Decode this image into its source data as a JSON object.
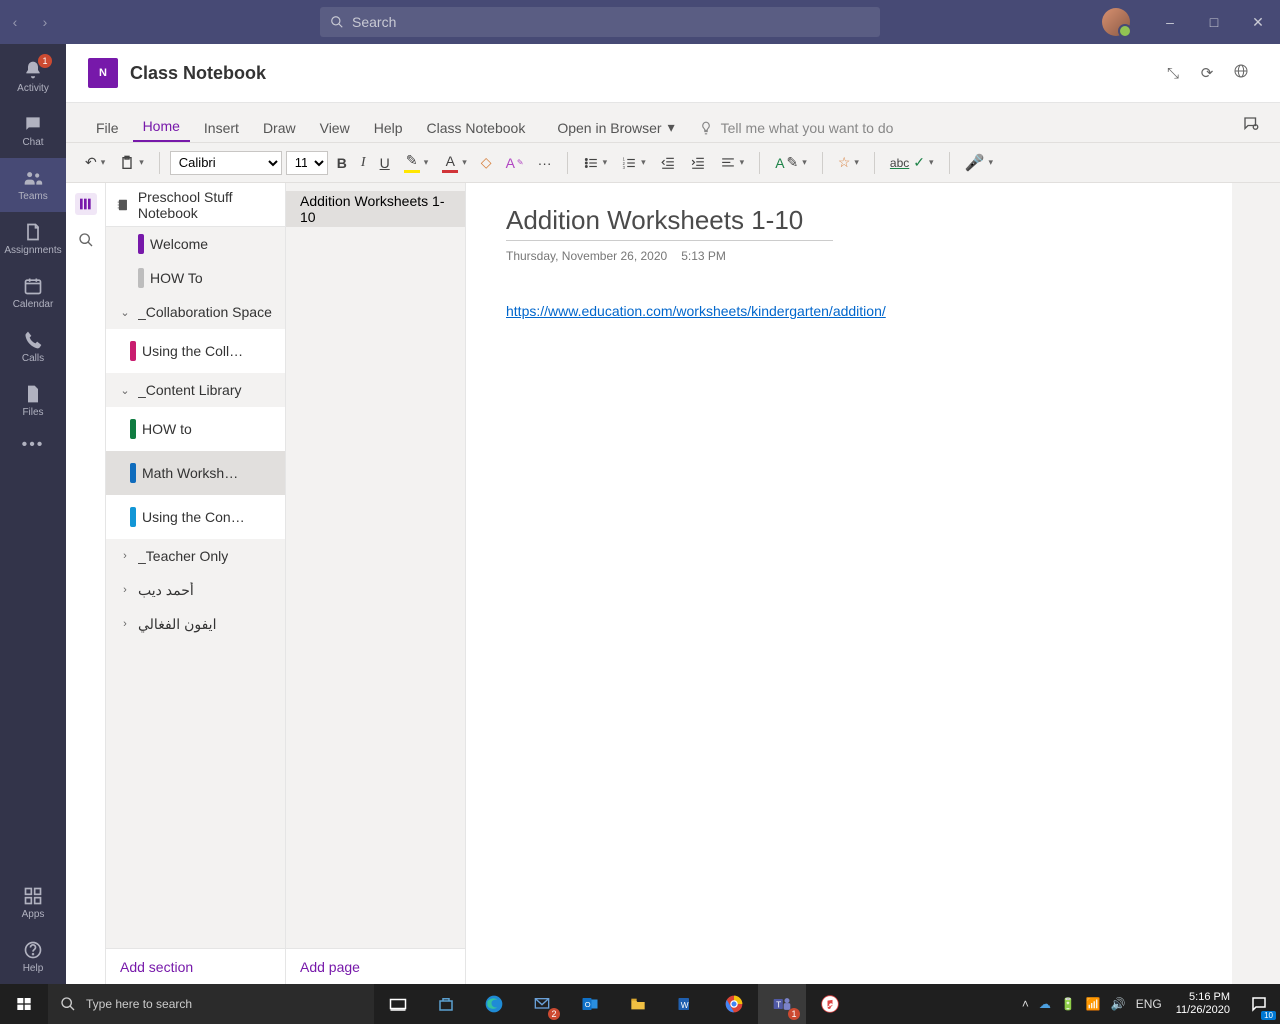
{
  "titlebar": {
    "search_placeholder": "Search"
  },
  "rail": {
    "items": [
      {
        "label": "Activity",
        "badge": "1"
      },
      {
        "label": "Chat"
      },
      {
        "label": "Teams"
      },
      {
        "label": "Assignments"
      },
      {
        "label": "Calendar"
      },
      {
        "label": "Calls"
      },
      {
        "label": "Files"
      }
    ],
    "apps": "Apps",
    "help": "Help"
  },
  "header": {
    "title": "Class Notebook",
    "logo": "N"
  },
  "tabs": {
    "items": [
      "File",
      "Home",
      "Insert",
      "Draw",
      "View",
      "Help",
      "Class Notebook"
    ],
    "active": 1,
    "open_in_browser": "Open in Browser",
    "tell_me": "Tell me what you want to do"
  },
  "ribbon": {
    "font": "Calibri",
    "size": "11",
    "spell": "abc"
  },
  "notebook": {
    "name": "Preschool Stuff Notebook",
    "sections": [
      {
        "label": "Welcome",
        "color": "#7719aa",
        "type": "page"
      },
      {
        "label": "HOW To",
        "color": "#bdbdbd",
        "type": "page"
      },
      {
        "label": "_Collaboration Space",
        "type": "group",
        "expanded": true,
        "children": [
          {
            "label": "Using the Collabora...",
            "color": "#c91d6f"
          }
        ]
      },
      {
        "label": "_Content Library",
        "type": "group",
        "expanded": true,
        "children": [
          {
            "label": "HOW to",
            "color": "#107c41"
          },
          {
            "label": "Math Worksheets",
            "color": "#0f6cbd",
            "selected": true
          },
          {
            "label": "Using the Content ...",
            "color": "#1296d6"
          }
        ]
      },
      {
        "label": "_Teacher Only",
        "type": "group",
        "expanded": false
      },
      {
        "label": "أحمد ديب",
        "type": "group",
        "expanded": false
      },
      {
        "label": "ايفون الفغالي",
        "type": "group",
        "expanded": false
      }
    ],
    "add_section": "Add section"
  },
  "pagelist": {
    "pages": [
      {
        "label": "Addition Worksheets 1-10",
        "selected": true
      }
    ],
    "add_page": "Add page"
  },
  "page": {
    "title": "Addition Worksheets 1-10",
    "date": "Thursday, November 26, 2020",
    "time": "5:13 PM",
    "link_text": "https://www.education.com/worksheets/kindergarten/addition/"
  },
  "taskbar": {
    "search_placeholder": "Type here to search",
    "lang": "ENG",
    "time": "5:16 PM",
    "date": "11/26/2020",
    "mail_badge": "2",
    "teams_badge": "1",
    "notif_badge": "10"
  }
}
